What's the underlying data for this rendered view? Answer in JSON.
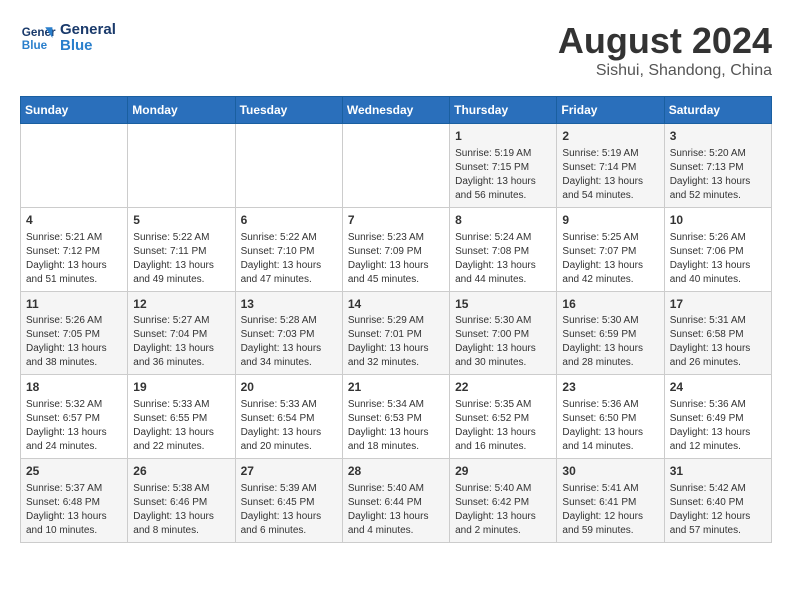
{
  "logo": {
    "line1": "General",
    "line2": "Blue"
  },
  "title": "August 2024",
  "location": "Sishui, Shandong, China",
  "days_of_week": [
    "Sunday",
    "Monday",
    "Tuesday",
    "Wednesday",
    "Thursday",
    "Friday",
    "Saturday"
  ],
  "weeks": [
    [
      {
        "day": "",
        "info": ""
      },
      {
        "day": "",
        "info": ""
      },
      {
        "day": "",
        "info": ""
      },
      {
        "day": "",
        "info": ""
      },
      {
        "day": "1",
        "info": "Sunrise: 5:19 AM\nSunset: 7:15 PM\nDaylight: 13 hours\nand 56 minutes."
      },
      {
        "day": "2",
        "info": "Sunrise: 5:19 AM\nSunset: 7:14 PM\nDaylight: 13 hours\nand 54 minutes."
      },
      {
        "day": "3",
        "info": "Sunrise: 5:20 AM\nSunset: 7:13 PM\nDaylight: 13 hours\nand 52 minutes."
      }
    ],
    [
      {
        "day": "4",
        "info": "Sunrise: 5:21 AM\nSunset: 7:12 PM\nDaylight: 13 hours\nand 51 minutes."
      },
      {
        "day": "5",
        "info": "Sunrise: 5:22 AM\nSunset: 7:11 PM\nDaylight: 13 hours\nand 49 minutes."
      },
      {
        "day": "6",
        "info": "Sunrise: 5:22 AM\nSunset: 7:10 PM\nDaylight: 13 hours\nand 47 minutes."
      },
      {
        "day": "7",
        "info": "Sunrise: 5:23 AM\nSunset: 7:09 PM\nDaylight: 13 hours\nand 45 minutes."
      },
      {
        "day": "8",
        "info": "Sunrise: 5:24 AM\nSunset: 7:08 PM\nDaylight: 13 hours\nand 44 minutes."
      },
      {
        "day": "9",
        "info": "Sunrise: 5:25 AM\nSunset: 7:07 PM\nDaylight: 13 hours\nand 42 minutes."
      },
      {
        "day": "10",
        "info": "Sunrise: 5:26 AM\nSunset: 7:06 PM\nDaylight: 13 hours\nand 40 minutes."
      }
    ],
    [
      {
        "day": "11",
        "info": "Sunrise: 5:26 AM\nSunset: 7:05 PM\nDaylight: 13 hours\nand 38 minutes."
      },
      {
        "day": "12",
        "info": "Sunrise: 5:27 AM\nSunset: 7:04 PM\nDaylight: 13 hours\nand 36 minutes."
      },
      {
        "day": "13",
        "info": "Sunrise: 5:28 AM\nSunset: 7:03 PM\nDaylight: 13 hours\nand 34 minutes."
      },
      {
        "day": "14",
        "info": "Sunrise: 5:29 AM\nSunset: 7:01 PM\nDaylight: 13 hours\nand 32 minutes."
      },
      {
        "day": "15",
        "info": "Sunrise: 5:30 AM\nSunset: 7:00 PM\nDaylight: 13 hours\nand 30 minutes."
      },
      {
        "day": "16",
        "info": "Sunrise: 5:30 AM\nSunset: 6:59 PM\nDaylight: 13 hours\nand 28 minutes."
      },
      {
        "day": "17",
        "info": "Sunrise: 5:31 AM\nSunset: 6:58 PM\nDaylight: 13 hours\nand 26 minutes."
      }
    ],
    [
      {
        "day": "18",
        "info": "Sunrise: 5:32 AM\nSunset: 6:57 PM\nDaylight: 13 hours\nand 24 minutes."
      },
      {
        "day": "19",
        "info": "Sunrise: 5:33 AM\nSunset: 6:55 PM\nDaylight: 13 hours\nand 22 minutes."
      },
      {
        "day": "20",
        "info": "Sunrise: 5:33 AM\nSunset: 6:54 PM\nDaylight: 13 hours\nand 20 minutes."
      },
      {
        "day": "21",
        "info": "Sunrise: 5:34 AM\nSunset: 6:53 PM\nDaylight: 13 hours\nand 18 minutes."
      },
      {
        "day": "22",
        "info": "Sunrise: 5:35 AM\nSunset: 6:52 PM\nDaylight: 13 hours\nand 16 minutes."
      },
      {
        "day": "23",
        "info": "Sunrise: 5:36 AM\nSunset: 6:50 PM\nDaylight: 13 hours\nand 14 minutes."
      },
      {
        "day": "24",
        "info": "Sunrise: 5:36 AM\nSunset: 6:49 PM\nDaylight: 13 hours\nand 12 minutes."
      }
    ],
    [
      {
        "day": "25",
        "info": "Sunrise: 5:37 AM\nSunset: 6:48 PM\nDaylight: 13 hours\nand 10 minutes."
      },
      {
        "day": "26",
        "info": "Sunrise: 5:38 AM\nSunset: 6:46 PM\nDaylight: 13 hours\nand 8 minutes."
      },
      {
        "day": "27",
        "info": "Sunrise: 5:39 AM\nSunset: 6:45 PM\nDaylight: 13 hours\nand 6 minutes."
      },
      {
        "day": "28",
        "info": "Sunrise: 5:40 AM\nSunset: 6:44 PM\nDaylight: 13 hours\nand 4 minutes."
      },
      {
        "day": "29",
        "info": "Sunrise: 5:40 AM\nSunset: 6:42 PM\nDaylight: 13 hours\nand 2 minutes."
      },
      {
        "day": "30",
        "info": "Sunrise: 5:41 AM\nSunset: 6:41 PM\nDaylight: 12 hours\nand 59 minutes."
      },
      {
        "day": "31",
        "info": "Sunrise: 5:42 AM\nSunset: 6:40 PM\nDaylight: 12 hours\nand 57 minutes."
      }
    ]
  ]
}
